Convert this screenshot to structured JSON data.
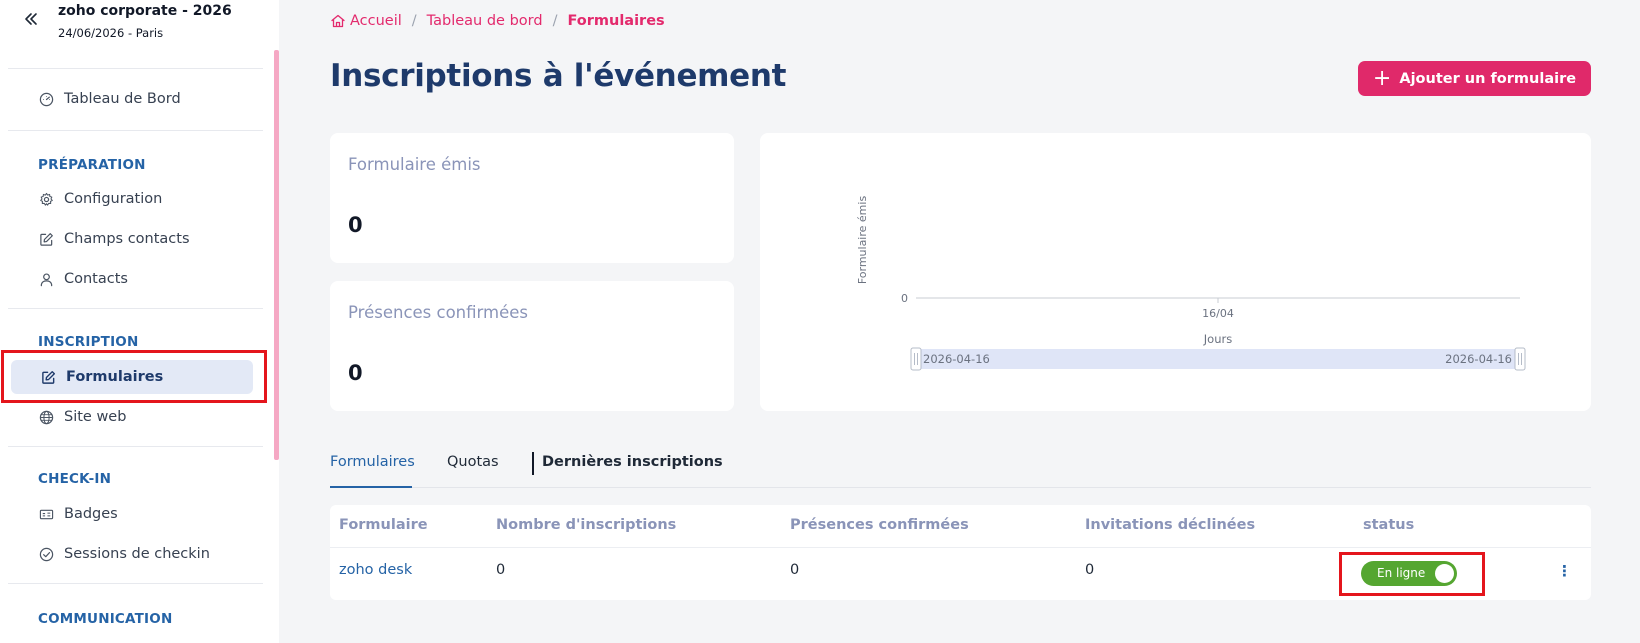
{
  "sidebar": {
    "event_name": "zoho corporate - 2026",
    "event_date": "24/06/2026 - Paris",
    "dashboard_label": "Tableau de Bord",
    "sections": {
      "preparation": "PRÉPARATION",
      "inscription": "INSCRIPTION",
      "checkin": "CHECK-IN",
      "communication": "COMMUNICATION"
    },
    "items": {
      "configuration": "Configuration",
      "champs_contacts": "Champs contacts",
      "contacts": "Contacts",
      "formulaires": "Formulaires",
      "site_web": "Site web",
      "badges": "Badges",
      "sessions_checkin": "Sessions de checkin"
    }
  },
  "breadcrumb": {
    "home": "Accueil",
    "dashboard": "Tableau de bord",
    "current": "Formulaires"
  },
  "page": {
    "title": "Inscriptions à l'événement",
    "add_button": "Ajouter un formulaire"
  },
  "stats": {
    "forms_emitted_label": "Formulaire émis",
    "forms_emitted_value": "0",
    "confirmed_label": "Présences confirmées",
    "confirmed_value": "0"
  },
  "chart_data": {
    "type": "line",
    "x": [
      "16/04"
    ],
    "series": [
      {
        "values": [
          0
        ]
      }
    ],
    "ylabel": "Formulaire émis",
    "xlabel": "Jours",
    "y_ticks": [
      "0"
    ],
    "range_start": "2026-04-16",
    "range_end": "2026-04-16"
  },
  "tabs": {
    "formulaires": "Formulaires",
    "quotas": "Quotas",
    "dernieres": "Dernières inscriptions"
  },
  "table": {
    "headers": {
      "formulaire": "Formulaire",
      "nombre": "Nombre d'inscriptions",
      "presences": "Présences confirmées",
      "invitations": "Invitations déclinées",
      "status": "status"
    },
    "rows": [
      {
        "formulaire": "zoho desk",
        "nombre": "0",
        "presences": "0",
        "invitations": "0",
        "status": "En ligne",
        "status_on": true
      }
    ]
  },
  "colors": {
    "accent": "#e0296a",
    "title": "#1e3a6b",
    "section": "#2563a6",
    "online": "#55a631",
    "highlight": "#e4151c"
  }
}
